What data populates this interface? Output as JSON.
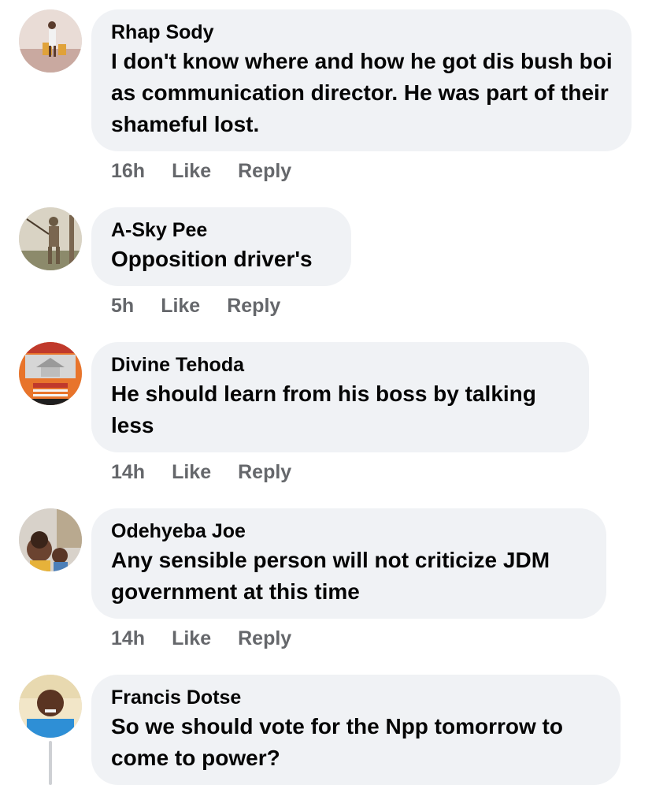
{
  "comments": [
    {
      "author": "Rhap Sody",
      "text": "I don't know where and how he got dis bush boi as communication director. He was part of their shameful lost.",
      "time": "16h",
      "like": "Like",
      "reply": "Reply",
      "avatar_icon": "person-carrying-water-avatar"
    },
    {
      "author": "A-Sky Pee",
      "text": "Opposition driver's",
      "time": "5h",
      "like": "Like",
      "reply": "Reply",
      "avatar_icon": "warrior-statue-avatar"
    },
    {
      "author": "Divine Tehoda",
      "text": "He should learn from his boss by talking less",
      "time": "14h",
      "like": "Like",
      "reply": "Reply",
      "avatar_icon": "construction-flyer-avatar"
    },
    {
      "author": "Odehyeba Joe",
      "text": "Any sensible person will not criticize JDM government at this time",
      "time": "14h",
      "like": "Like",
      "reply": "Reply",
      "avatar_icon": "children-photo-avatar"
    },
    {
      "author": "Francis Dotse",
      "text": "So we should vote for the Npp tomorrow to come to power?",
      "avatar_icon": "man-selfie-avatar"
    }
  ]
}
